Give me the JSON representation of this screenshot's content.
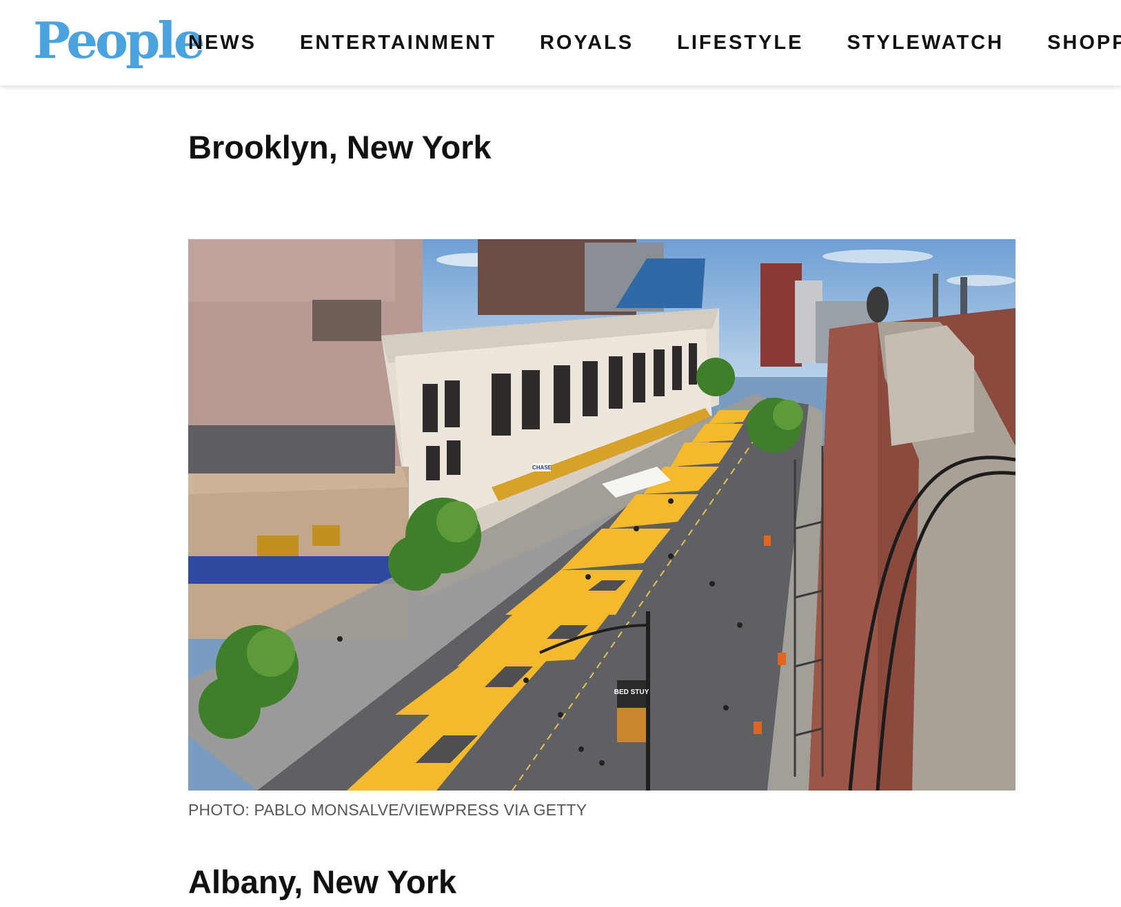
{
  "brand": {
    "logo_text": "People",
    "logo_color": "#4aa3df"
  },
  "nav": {
    "items": [
      {
        "label": "NEWS"
      },
      {
        "label": "ENTERTAINMENT"
      },
      {
        "label": "ROYALS"
      },
      {
        "label": "LIFESTYLE"
      },
      {
        "label": "STYLEWATCH"
      },
      {
        "label": "SHOPPING"
      }
    ]
  },
  "article": {
    "section_title": "Brooklyn, New York",
    "photo_caption": "PHOTO: PABLO MONSALVE/VIEWPRESS VIA GETTY",
    "next_section_title": "Albany, New York"
  },
  "photo": {
    "street_text": "BLACKLIVESMATTER",
    "banner_text": "BED STUY",
    "bank_sign": "CHASE"
  },
  "colors": {
    "street_paint": "#f4b92d",
    "asphalt": "#5f6063",
    "sky": "#7fa9d6"
  }
}
